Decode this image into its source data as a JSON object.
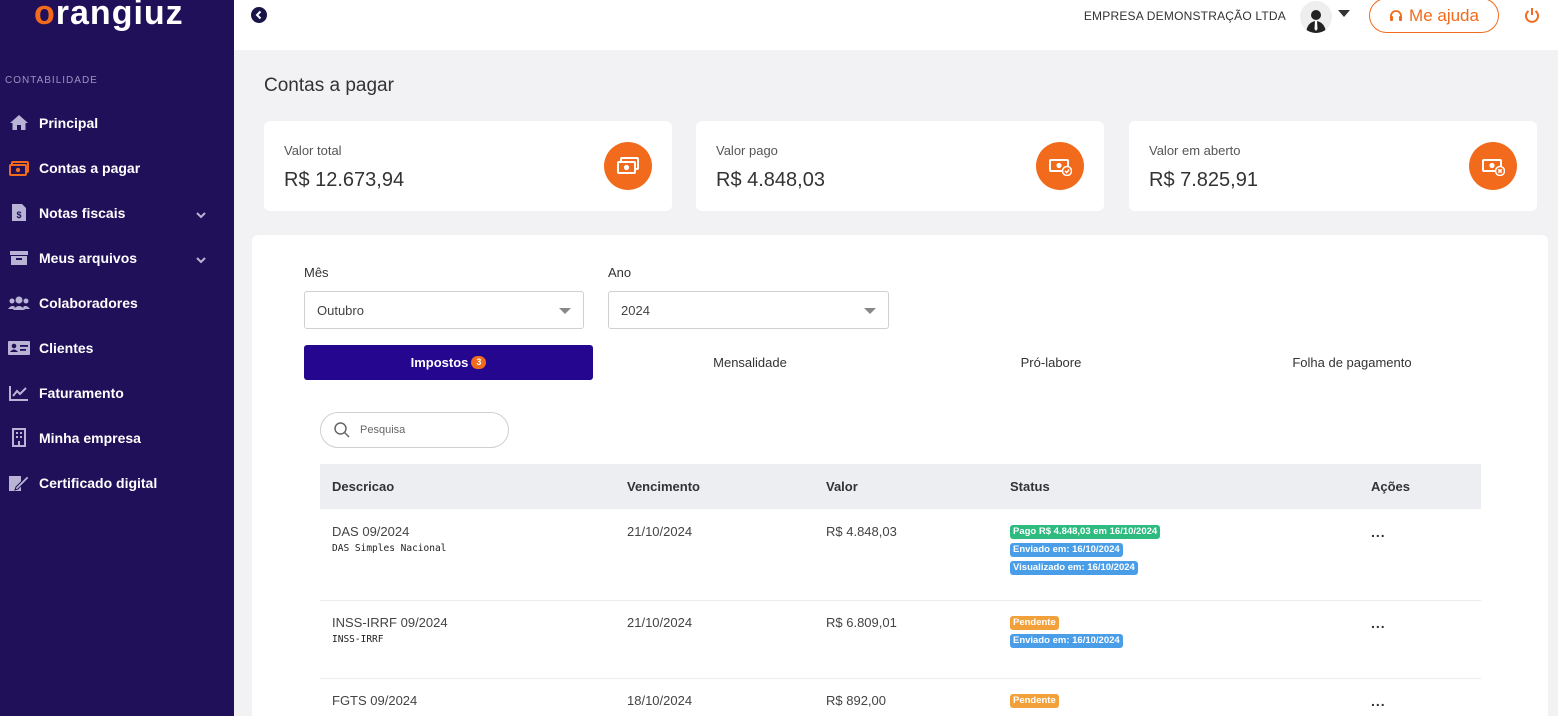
{
  "sidebar": {
    "logo": {
      "first": "o",
      "rest": "rangiuz"
    },
    "section": "CONTABILIDADE",
    "items": [
      {
        "label": "Principal",
        "icon": "home-icon"
      },
      {
        "label": "Contas a pagar",
        "icon": "money-icon"
      },
      {
        "label": "Notas fiscais",
        "icon": "invoice-icon"
      },
      {
        "label": "Meus arquivos",
        "icon": "archive-icon"
      },
      {
        "label": "Colaboradores",
        "icon": "users-icon"
      },
      {
        "label": "Clientes",
        "icon": "id-card-icon"
      },
      {
        "label": "Faturamento",
        "icon": "chart-line-icon"
      },
      {
        "label": "Minha empresa",
        "icon": "building-icon"
      },
      {
        "label": "Certificado digital",
        "icon": "certificate-icon"
      }
    ]
  },
  "topbar": {
    "company": "EMPRESA DEMONSTRAÇÃO LTDA",
    "help": "Me ajuda"
  },
  "page": {
    "title": "Contas a pagar"
  },
  "cards": [
    {
      "label": "Valor total",
      "value": "R$ 12.673,94",
      "icon": "money-stack-icon"
    },
    {
      "label": "Valor pago",
      "value": "R$ 4.848,03",
      "icon": "money-check-icon"
    },
    {
      "label": "Valor em aberto",
      "value": "R$ 7.825,91",
      "icon": "money-x-icon"
    }
  ],
  "filters": {
    "month_label": "Mês",
    "month_value": "Outubro",
    "year_label": "Ano",
    "year_value": "2024"
  },
  "tabs": [
    {
      "label": "Impostos",
      "badge": "3"
    },
    {
      "label": "Mensalidade"
    },
    {
      "label": "Pró-labore"
    },
    {
      "label": "Folha de pagamento"
    }
  ],
  "search": {
    "placeholder": "Pesquisa"
  },
  "table": {
    "headers": [
      "Descricao",
      "Vencimento",
      "Valor",
      "Status",
      "Ações"
    ],
    "rows": [
      {
        "desc": "DAS 09/2024",
        "sub": "DAS Simples Nacional",
        "due": "21/10/2024",
        "value": "R$ 4.848,03",
        "status": [
          "Pago R$ 4.848,03 em 16/10/2024",
          "Enviado em: 16/10/2024",
          "Visualizado em: 16/10/2024"
        ],
        "actions": "..."
      },
      {
        "desc": "INSS-IRRF 09/2024",
        "sub": "INSS-IRRF",
        "due": "21/10/2024",
        "value": "R$ 6.809,01",
        "status": [
          "Pendente",
          "Enviado em: 16/10/2024"
        ],
        "actions": "..."
      },
      {
        "desc": "FGTS 09/2024",
        "sub": "",
        "due": "18/10/2024",
        "value": "R$ 892,00",
        "status": [
          "Pendente"
        ],
        "actions": "..."
      }
    ]
  },
  "colors": {
    "accent": "#f26a1b",
    "sidebar": "#20105a",
    "active_tab": "#24068f"
  }
}
